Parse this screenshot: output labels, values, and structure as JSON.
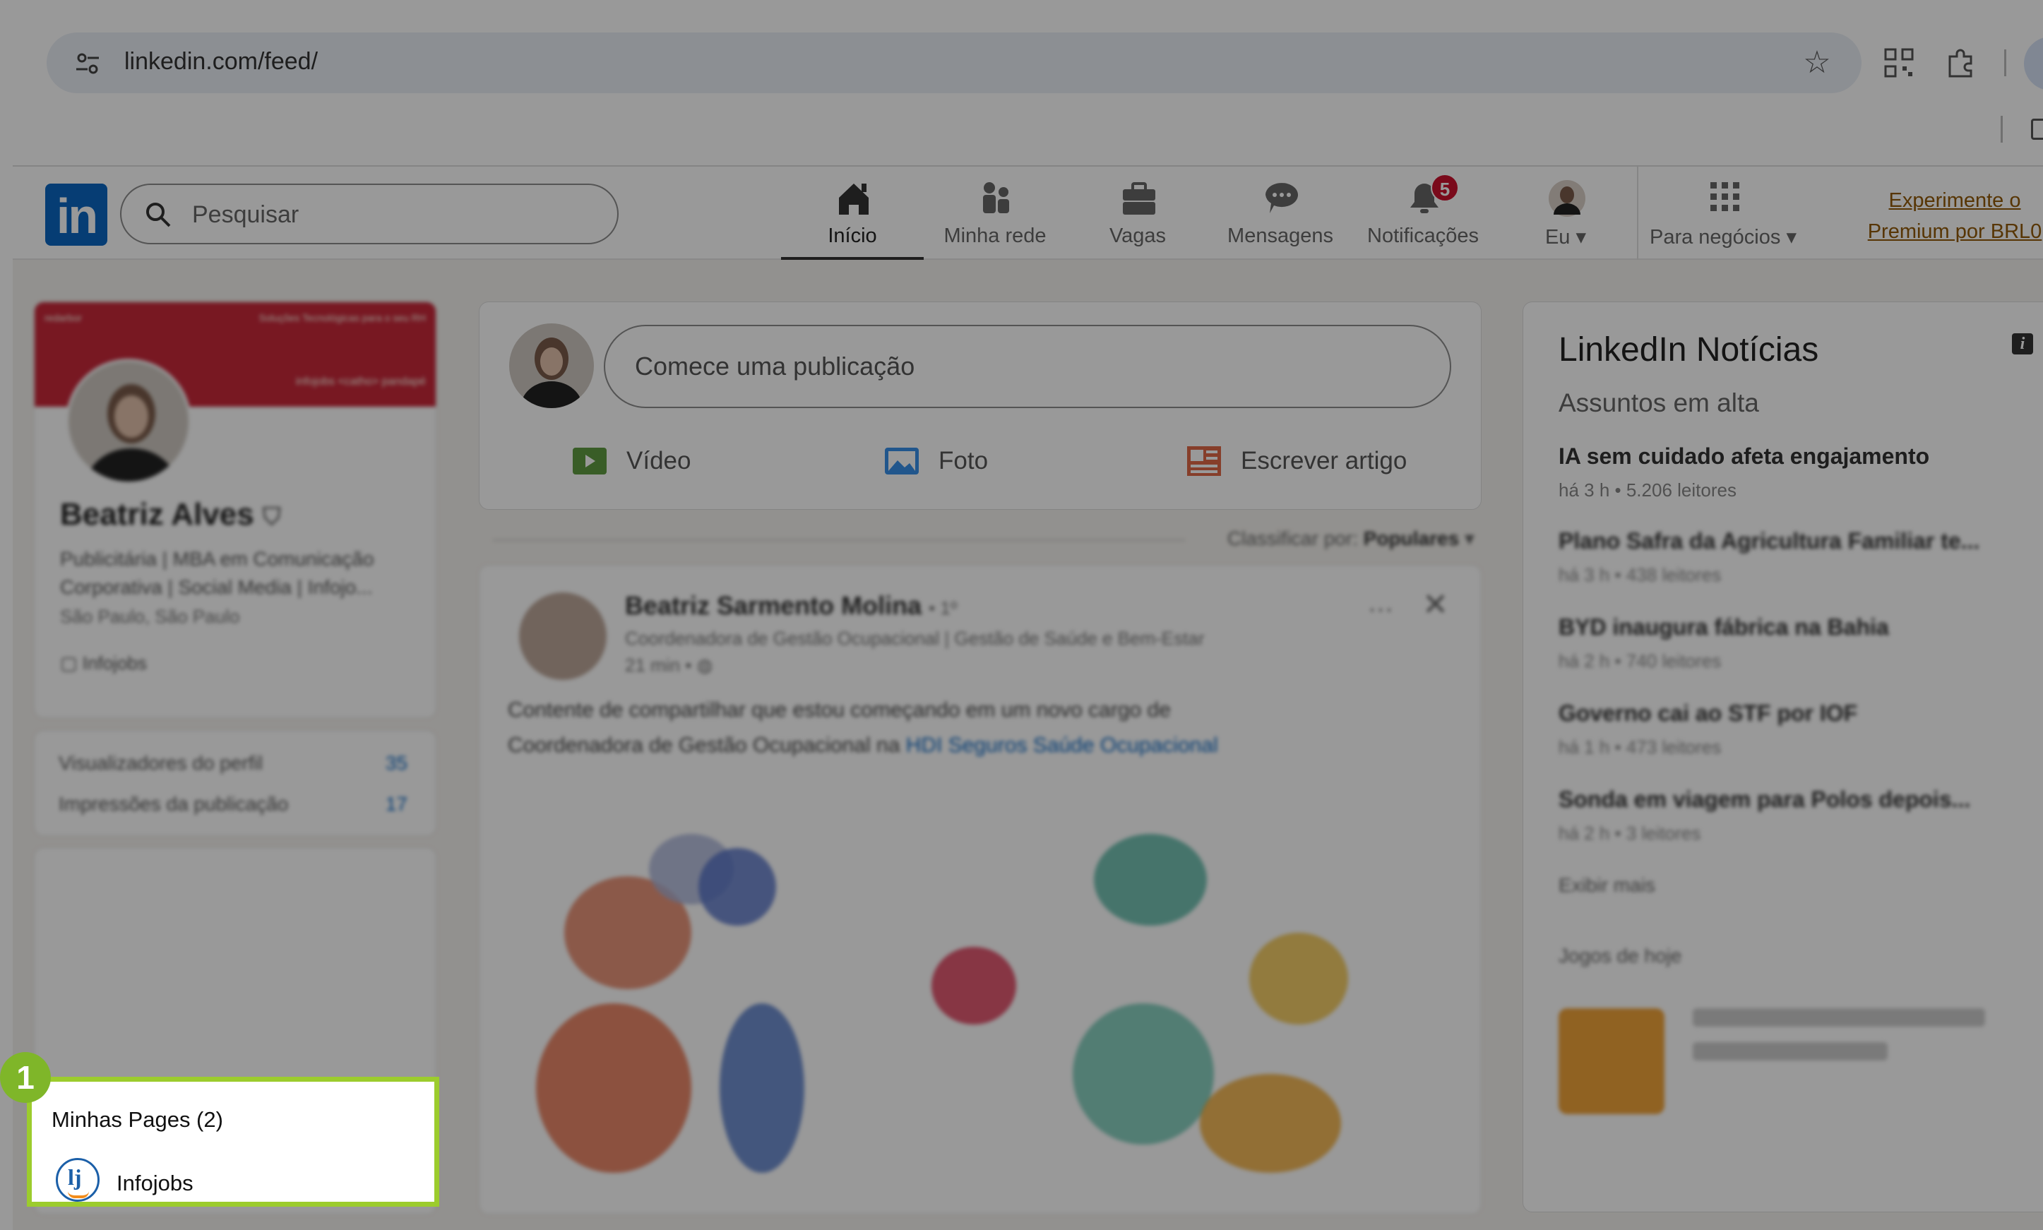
{
  "browser": {
    "url": "linkedin.com/feed/",
    "icons": [
      "site-settings-icon",
      "star-icon",
      "qr-code-icon",
      "extensions-icon",
      "profile-chip",
      "tab-strip-icon"
    ]
  },
  "header": {
    "logo": "in",
    "search_placeholder": "Pesquisar",
    "nav": [
      {
        "label": "Início",
        "icon": "home-icon",
        "active": true
      },
      {
        "label": "Minha rede",
        "icon": "network-icon"
      },
      {
        "label": "Vagas",
        "icon": "jobs-icon"
      },
      {
        "label": "Mensagens",
        "icon": "messaging-icon"
      },
      {
        "label": "Notificações",
        "icon": "bell-icon",
        "badge": "5"
      },
      {
        "label": "Eu",
        "icon": "avatar-icon"
      }
    ],
    "business_label": "Para negócios",
    "premium_line1": "Experimente o",
    "premium_line2": "Premium por BRL0"
  },
  "profile": {
    "cover_left": "redarbor",
    "cover_right": "Soluções Tecnológicas para o seu RH",
    "cover_brands": "infojobs  <catho>  pandapé",
    "name": "Beatriz Alves",
    "headline_line1": "Publicitária | MBA em Comunicação",
    "headline_line2": "Corporativa | Social Media | Infojo...",
    "location": "São Paulo, São Paulo",
    "company": "Infojobs"
  },
  "stats": {
    "row1_label": "Visualizadores do perfil",
    "row1_value": "35",
    "row2_label": "Impressões da publicação",
    "row2_value": "17"
  },
  "share": {
    "placeholder": "Comece uma publicação",
    "actions": [
      {
        "label": "Vídeo",
        "icon": "video-icon",
        "color": "#5f9b41"
      },
      {
        "label": "Foto",
        "icon": "photo-icon",
        "color": "#378fe9"
      },
      {
        "label": "Escrever artigo",
        "icon": "article-icon",
        "color": "#e06847"
      }
    ]
  },
  "sort": {
    "prefix": "Classificar por:",
    "value": "Populares"
  },
  "post": {
    "author": "Beatriz Sarmento Molina",
    "degree": "• 1º",
    "subtitle": "Coordenadora de Gestão Ocupacional | Gestão de Saúde e Bem-Estar",
    "time": "21 min •",
    "text_line1": "Contente de compartilhar que estou começando em um novo cargo de",
    "text_line2": "Coordenadora de Gestão Ocupacional na",
    "text_link": "HDI Seguros Saúde Ocupacional"
  },
  "news": {
    "title": "LinkedIn Notícias",
    "subtitle": "Assuntos em alta",
    "items": [
      {
        "headline": "IA sem cuidado afeta engajamento",
        "meta": "há 3 h • 5.206 leitores"
      },
      {
        "headline": "Plano Safra da Agricultura Familiar te...",
        "meta": "há 3 h • 438 leitores"
      },
      {
        "headline": "BYD inaugura fábrica na Bahia",
        "meta": "há 2 h • 740 leitores"
      },
      {
        "headline": "Governo cai ao STF por IOF",
        "meta": "há 1 h • 473 leitores"
      },
      {
        "headline": "Sonda em viagem para Polos depois...",
        "meta": "há 2 h • 3 leitores"
      }
    ],
    "more": "Exibir mais",
    "puzzles_title": "Jogos de hoje"
  },
  "callout": {
    "step": "1",
    "title": "Minhas Pages (2)",
    "page_name": "Infojobs",
    "logo_text": "lj"
  },
  "colors": {
    "brand": "#0a66c2",
    "highlight": "#9ccc2d",
    "step_badge": "#7fb629",
    "badge_red": "#cb112d"
  }
}
